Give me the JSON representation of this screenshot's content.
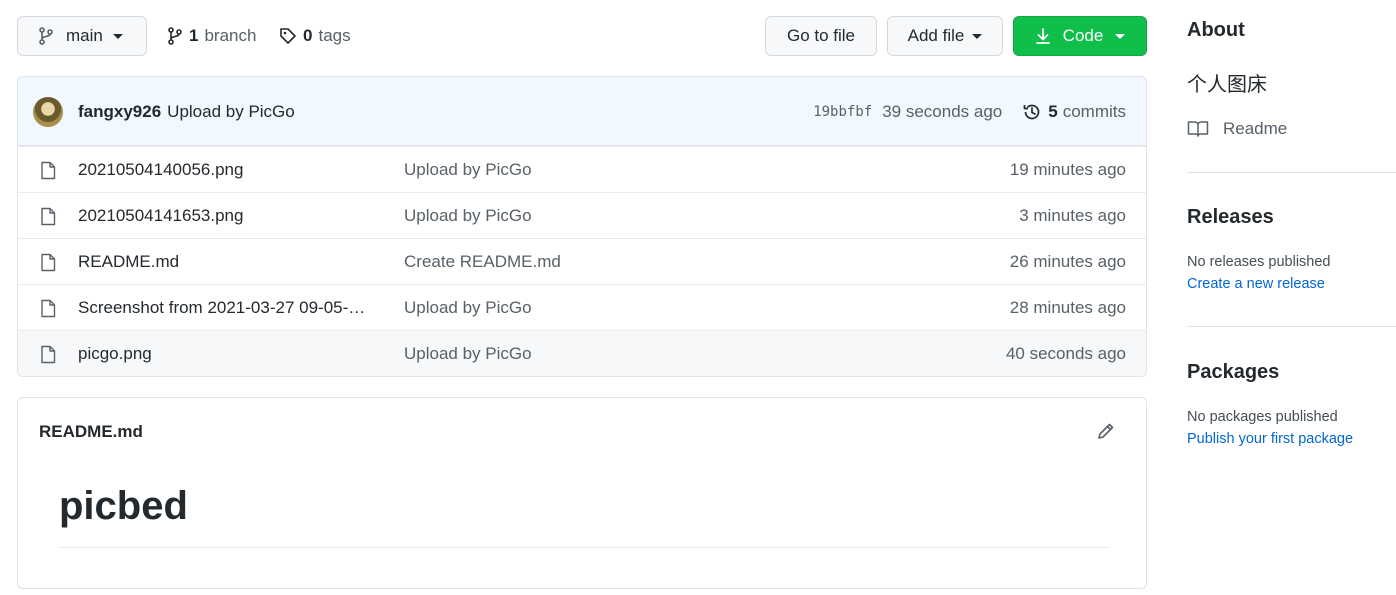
{
  "toolbar": {
    "branch_selected": "main",
    "branch_count": "1",
    "branch_word": "branch",
    "tag_count": "0",
    "tag_word": "tags",
    "go_to_file": "Go to file",
    "add_file": "Add file",
    "code": "Code",
    "code_color": "#0fbf4a"
  },
  "commit": {
    "author": "fangxy926",
    "message": "Upload by PicGo",
    "sha": "19bbfbf",
    "time": "39 seconds ago",
    "commit_count": "5",
    "commit_word": "commits"
  },
  "files": [
    {
      "name": "20210504140056.png",
      "message": "Upload by PicGo",
      "age": "19 minutes ago"
    },
    {
      "name": "20210504141653.png",
      "message": "Upload by PicGo",
      "age": "3 minutes ago"
    },
    {
      "name": "README.md",
      "message": "Create README.md",
      "age": "26 minutes ago"
    },
    {
      "name": "Screenshot from 2021-03-27 09-05-…",
      "message": "Upload by PicGo",
      "age": "28 minutes ago"
    },
    {
      "name": "picgo.png",
      "message": "Upload by PicGo",
      "age": "40 seconds ago"
    }
  ],
  "readme": {
    "title": "README.md",
    "heading": "picbed"
  },
  "sidebar": {
    "about_heading": "About",
    "description": "个人图床",
    "readme_link": "Readme",
    "releases_heading": "Releases",
    "releases_none": "No releases published",
    "releases_link": "Create a new release",
    "packages_heading": "Packages",
    "packages_none": "No packages published",
    "packages_link": "Publish your first package"
  }
}
